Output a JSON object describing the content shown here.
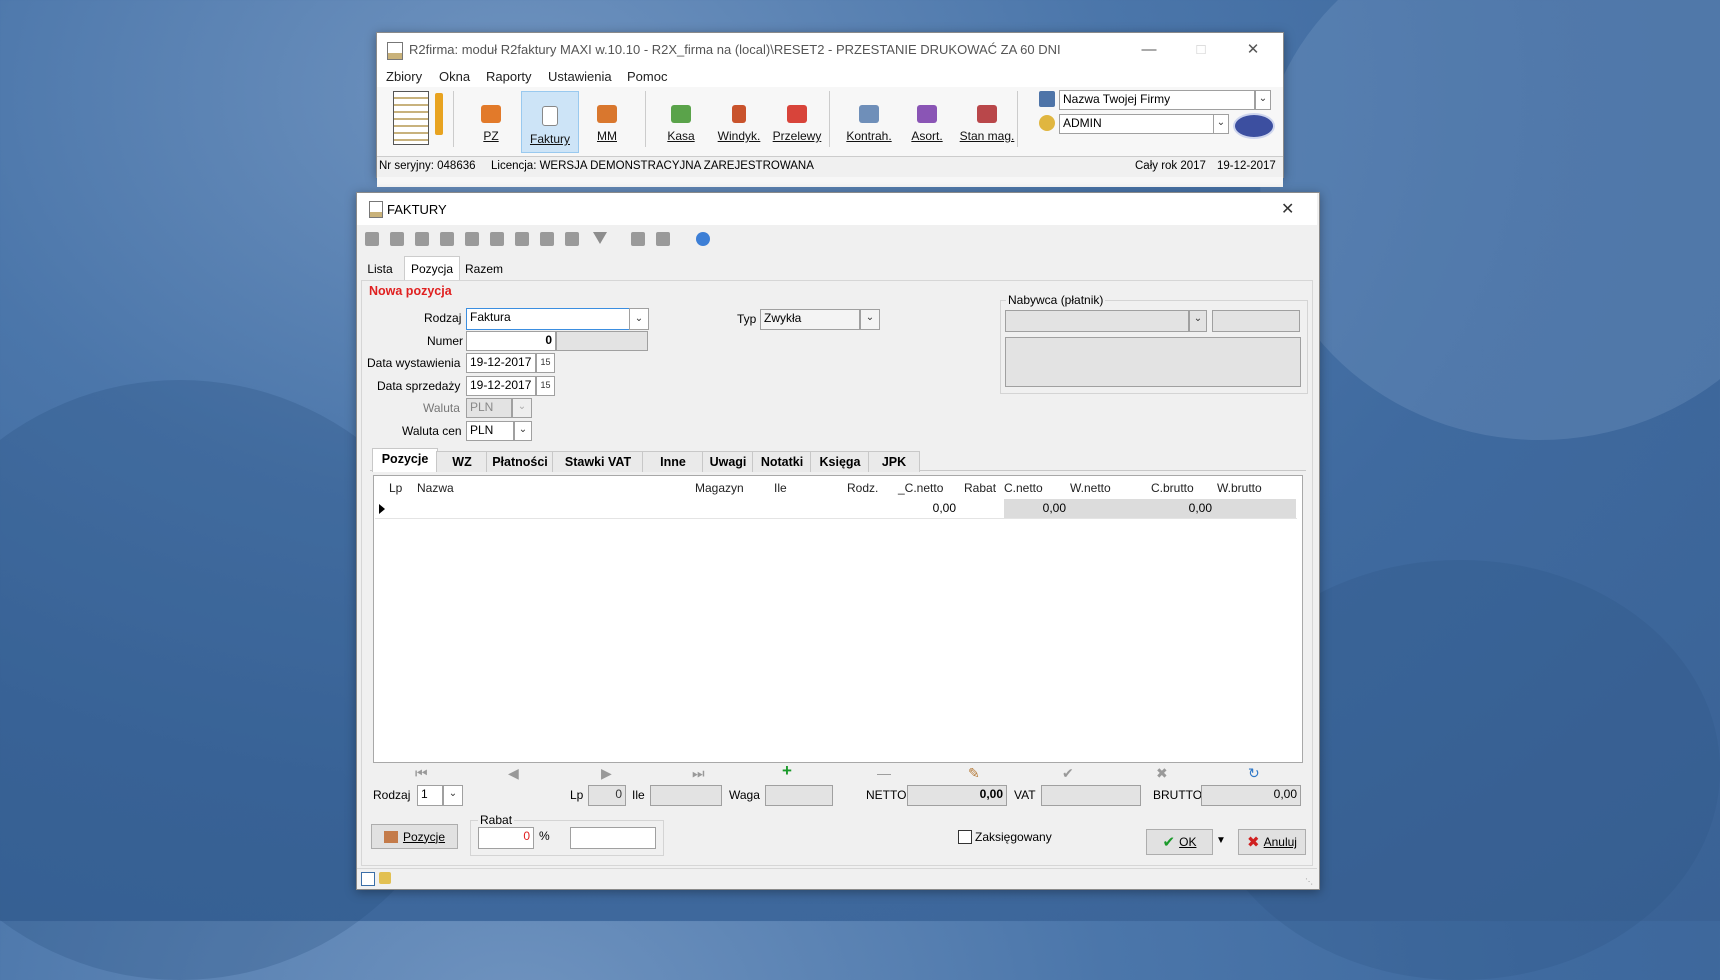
{
  "main_window": {
    "title": "R2firma: moduł R2faktury MAXI w.10.10 - R2X_firma na (local)\\RESET2 - PRZESTANIE DRUKOWAĆ ZA 60 DNI",
    "menu": [
      "Zbiory",
      "Okna",
      "Raporty",
      "Ustawienia",
      "Pomoc"
    ],
    "toolbar": [
      {
        "label": "PZ",
        "icon": "truck-icon"
      },
      {
        "label": "Faktury",
        "icon": "invoice-icon"
      },
      {
        "label": "MM",
        "icon": "transfer-truck-icon"
      },
      {
        "label": "Kasa",
        "icon": "cash-icon"
      },
      {
        "label": "Windyk.",
        "icon": "collection-icon"
      },
      {
        "label": "Przelewy",
        "icon": "transfer-icon"
      },
      {
        "label": "Kontrah.",
        "icon": "contractors-icon"
      },
      {
        "label": "Asort.",
        "icon": "assortment-icon"
      },
      {
        "label": "Stan mag.",
        "icon": "stock-icon"
      }
    ],
    "company_select": "Nazwa Twojej Firmy",
    "user_select": "ADMIN",
    "status": {
      "serial": "Nr seryjny: 048636",
      "license": "Licencja: WERSJA DEMONSTRACYJNA ZAREJESTROWANA",
      "period": "Cały rok 2017",
      "date": "19-12-2017"
    }
  },
  "faktury_window": {
    "title": "FAKTURY",
    "tabs": [
      "Lista",
      "Pozycja",
      "Razem"
    ],
    "section_title": "Nowa pozycja",
    "form": {
      "rodzaj_label": "Rodzaj",
      "rodzaj_value": "Faktura",
      "numer_label": "Numer",
      "numer_value": "0",
      "data_wyst_label": "Data wystawienia",
      "data_wyst_value": "19-12-2017",
      "data_sprz_label": "Data sprzedaży",
      "data_sprz_value": "19-12-2017",
      "waluta_label": "Waluta",
      "waluta_value": "PLN",
      "waluta_cen_label": "Waluta cen",
      "waluta_cen_value": "PLN",
      "typ_label": "Typ",
      "typ_value": "Zwykła",
      "nabywca_label": "Nabywca (płatnik)"
    },
    "subtabs": [
      "Pozycje",
      "WZ",
      "Płatności",
      "Stawki VAT",
      "Inne",
      "Uwagi",
      "Notatki",
      "Księga",
      "JPK"
    ],
    "grid": {
      "headers": [
        "Lp",
        "Nazwa",
        "Magazyn",
        "Ile",
        "Rodz.",
        "_C.netto",
        "Rabat",
        "C.netto",
        "W.netto",
        "C.brutto",
        "W.brutto"
      ],
      "row": {
        "c_netto_u": "0,00",
        "c_netto": "0,00",
        "c_brutto": "0,00"
      }
    },
    "bottom": {
      "rodzaj_label": "Rodzaj",
      "rodzaj_value": "1",
      "lp_label": "Lp",
      "lp_value": "0",
      "ile_label": "Ile",
      "waga_label": "Waga",
      "netto_label": "NETTO",
      "netto_value": "0,00",
      "vat_label": "VAT",
      "brutto_label": "BRUTTO",
      "brutto_value": "0,00"
    },
    "footer": {
      "pozycje_button": "Pozycje",
      "rabat_label": "Rabat",
      "rabat_value": "0",
      "percent": "%",
      "zaksiegowany_label": "Zaksięgowany",
      "ok_button": "OK",
      "anuluj_button": "Anuluj"
    }
  }
}
